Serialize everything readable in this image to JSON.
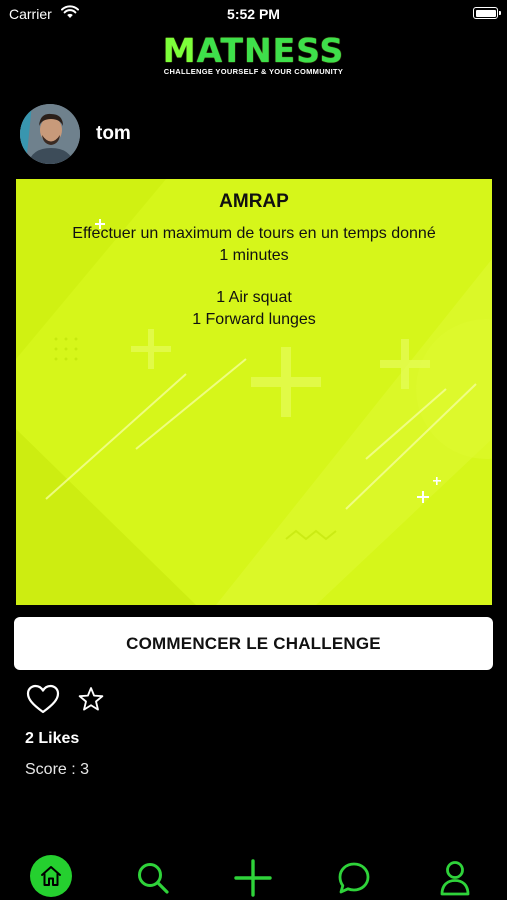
{
  "status_bar": {
    "carrier": "Carrier",
    "time": "5:52 PM",
    "wifi_icon": "wifi-icon",
    "battery_icon": "battery-icon"
  },
  "logo": {
    "first_letter": "M",
    "rest": "ATNESS",
    "tagline": "CHALLENGE YOURSELF & YOUR COMMUNITY",
    "colors": {
      "primary": "#3ee04b",
      "accent": "#7cff3a"
    }
  },
  "profile": {
    "username": "tom",
    "avatar_icon": "user-avatar"
  },
  "challenge": {
    "title": "AMRAP",
    "description": "Effectuer un maximum de tours en un temps donné",
    "duration": "1 minutes",
    "exercises": [
      "1 Air squat",
      "1 Forward lunges"
    ],
    "background_color": "#d6f61a"
  },
  "start_button": {
    "label": "COMMENCER LE CHALLENGE"
  },
  "actions": {
    "like_icon": "heart-icon",
    "favorite_icon": "star-icon",
    "likes_text": "2 Likes",
    "score_text": "Score : 3"
  },
  "tab_bar": {
    "items": [
      {
        "icon": "home-icon",
        "active": true
      },
      {
        "icon": "search-icon",
        "active": false
      },
      {
        "icon": "plus-icon",
        "active": false
      },
      {
        "icon": "chat-icon",
        "active": false
      },
      {
        "icon": "profile-icon",
        "active": false
      }
    ],
    "active_color": "#25d02f",
    "icon_color": "#2fd33a"
  }
}
